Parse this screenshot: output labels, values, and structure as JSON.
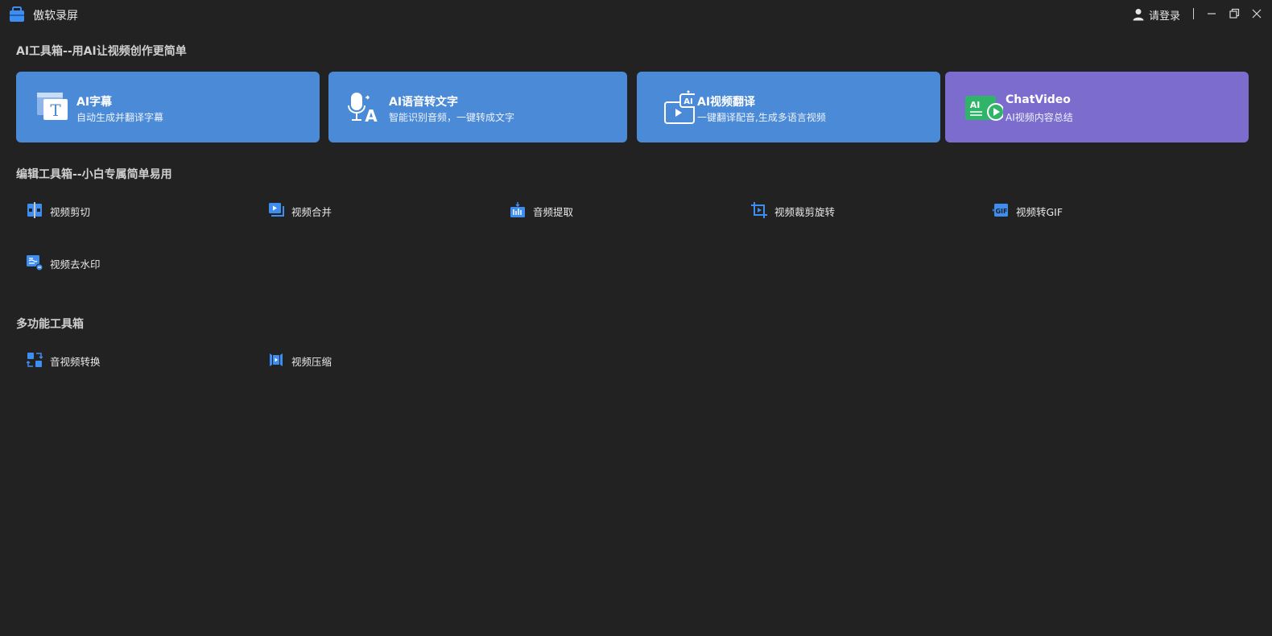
{
  "app": {
    "title": "傲软录屏"
  },
  "header": {
    "login_label": "请登录"
  },
  "sections": {
    "ai_toolbox_title": "AI工具箱--用AI让视频创作更简单",
    "edit_toolbox_title": "编辑工具箱--小白专属简单易用",
    "multi_toolbox_title": "多功能工具箱"
  },
  "ai_cards": [
    {
      "title": "AI字幕",
      "subtitle": "自动生成并翻译字幕",
      "color": "#4a8ad6",
      "icon": "subtitle-icon"
    },
    {
      "title": "AI语音转文字",
      "subtitle": "智能识别音频，一键转成文字",
      "color": "#4a8ad6",
      "icon": "microphone-text-icon"
    },
    {
      "title": "AI视频翻译",
      "subtitle": "一键翻译配音,生成多语言视频",
      "color": "#4a8ad6",
      "icon": "video-translate-icon"
    },
    {
      "title": "ChatVideo",
      "subtitle": "AI视频内容总结",
      "color": "#7b6ccd",
      "icon": "chatvideo-icon"
    }
  ],
  "edit_tools": [
    {
      "label": "视频剪切",
      "icon": "video-cut-icon"
    },
    {
      "label": "视频合并",
      "icon": "video-merge-icon"
    },
    {
      "label": "音频提取",
      "icon": "audio-extract-icon"
    },
    {
      "label": "视频裁剪旋转",
      "icon": "crop-rotate-icon"
    },
    {
      "label": "视频转GIF",
      "icon": "gif-icon"
    },
    {
      "label": "视频去水印",
      "icon": "watermark-remove-icon"
    }
  ],
  "multi_tools": [
    {
      "label": "音视频转换",
      "icon": "convert-icon"
    },
    {
      "label": "视频压缩",
      "icon": "compress-icon"
    }
  ],
  "colors": {
    "accent": "#3d8ef0",
    "card_blue": "#4a8ad6",
    "card_purple": "#7b6ccd",
    "background": "#222222"
  }
}
